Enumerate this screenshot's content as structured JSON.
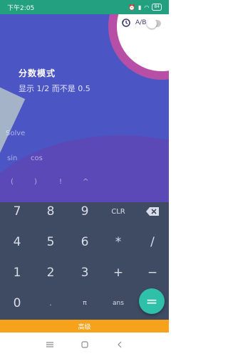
{
  "status_bar": {
    "time": "下午2:05",
    "battery": "84"
  },
  "tutorial": {
    "title": "分数模式",
    "description": "显示 1/2 而不是 0.5"
  },
  "toolbar": {
    "ab_label": "A/B",
    "history_icon": "history-icon",
    "fraction_toggle_on": false
  },
  "functions": {
    "solve": "Solve",
    "sin": "sin",
    "cos": "cos",
    "paren_open": "(",
    "paren_close": ")",
    "factorial": "!",
    "power": "^"
  },
  "keypad": {
    "row1": [
      "7",
      "8",
      "9",
      "CLR"
    ],
    "row2": [
      "4",
      "5",
      "6",
      "*",
      "/"
    ],
    "row3": [
      "1",
      "2",
      "3",
      "+",
      "−"
    ],
    "row4": [
      "0",
      ".",
      "π",
      "ans"
    ],
    "equals": "="
  },
  "advanced_bar": {
    "label": "高级"
  },
  "colors": {
    "status_bar": "#22a07f",
    "overlay": "#4b55c4",
    "ring": "#b74fa6",
    "keypad": "#3f4b62",
    "equals": "#2ec0a8",
    "advanced": "#f7a21b"
  }
}
